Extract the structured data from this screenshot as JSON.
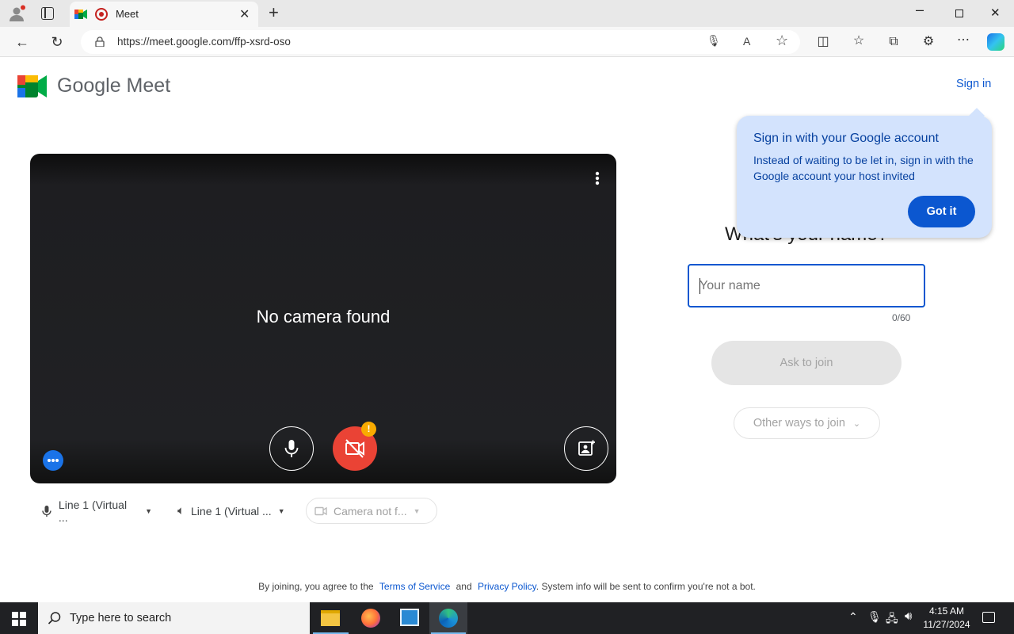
{
  "browser": {
    "tab_title": "Meet",
    "url": "https://meet.google.com/ffp-xsrd-oso",
    "window_controls": {
      "minimize": "minimize-icon",
      "restore": "restore-icon",
      "close": "close-icon"
    }
  },
  "meet": {
    "logo_text": "Google Meet",
    "sign_in": "Sign in",
    "video_status": "No camera found",
    "devices": {
      "microphone": "Line 1 (Virtual ...",
      "speaker": "Line 1 (Virtual ...",
      "camera": "Camera not f..."
    },
    "camera_alert_badge": "!",
    "tooltip": {
      "title": "Sign in with your Google account",
      "body": "Instead of waiting to be let in, sign in with the Google account your host invited",
      "button": "Got it"
    },
    "name_heading": "What's your name?",
    "name_input": {
      "value": "",
      "placeholder": "Your name",
      "counter": "0/60"
    },
    "ask_to_join": "Ask to join",
    "other_ways": "Other ways to join",
    "footer": {
      "prefix": "By joining, you agree to the",
      "terms": "Terms of Service",
      "and": "and",
      "privacy": "Privacy Policy",
      "suffix": ". System info will be sent to confirm you're not a bot."
    },
    "colors": {
      "blue": "#0b57d0",
      "red": "#ea4335",
      "orange": "#f9ab00",
      "tooltip_bg": "#d3e3fd"
    }
  },
  "taskbar": {
    "search_placeholder": "Type here to search",
    "time": "4:15 AM",
    "date": "11/27/2024"
  }
}
